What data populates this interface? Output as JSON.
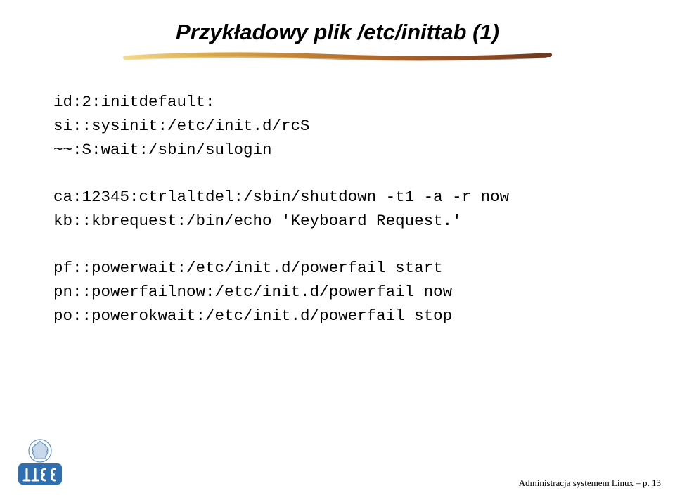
{
  "title": "Przykładowy plik /etc/inittab (1)",
  "code": {
    "line1": "id:2:initdefault:",
    "line2": "si::sysinit:/etc/init.d/rcS",
    "line3": "~~:S:wait:/sbin/sulogin",
    "line4": "ca:12345:ctrlaltdel:/sbin/shutdown -t1 -a -r now",
    "line5": "kb::kbrequest:/bin/echo 'Keyboard Request.'",
    "line6": "pf::powerwait:/etc/init.d/powerfail start",
    "line7": "pn::powerfailnow:/etc/init.d/powerfail now",
    "line8": "po::powerokwait:/etc/init.d/powerfail stop"
  },
  "footer": {
    "text": "Administracja systemem Linux – p. 13"
  }
}
